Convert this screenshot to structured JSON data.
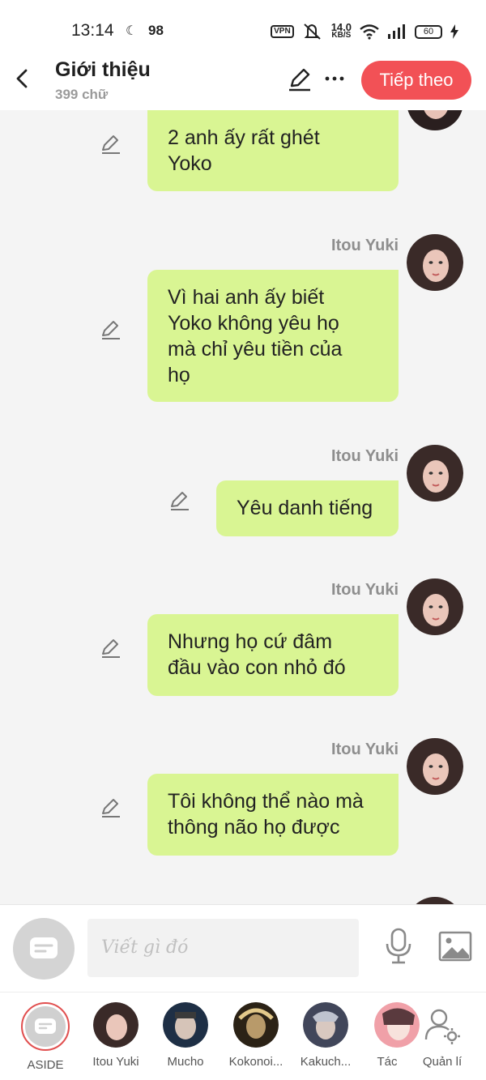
{
  "status_bar": {
    "time": "13:14",
    "notification_count": "98",
    "network_speed": "14.0",
    "network_unit": "KB/S",
    "vpn_label": "VPN",
    "battery": "60"
  },
  "header": {
    "title": "Giới thiệu",
    "subtitle": "399 chữ",
    "next_label": "Tiếp theo"
  },
  "messages": [
    {
      "sender": "",
      "text_lines": [
        "2 anh ấy rất ghét",
        "Yoko"
      ]
    },
    {
      "sender": "Itou Yuki",
      "text_lines": [
        "Vì hai anh ấy biết",
        "Yoko không yêu họ",
        "mà chỉ yêu tiền của",
        "họ"
      ]
    },
    {
      "sender": "Itou Yuki",
      "text_lines": [
        "Yêu danh tiếng"
      ]
    },
    {
      "sender": "Itou Yuki",
      "text_lines": [
        "Nhưng họ cứ đâm",
        "đầu vào con nhỏ đó"
      ]
    },
    {
      "sender": "Itou Yuki",
      "text_lines": [
        "Tôi không thể nào mà",
        "thông não họ được"
      ]
    }
  ],
  "input": {
    "placeholder": "Viết gì đó"
  },
  "characters": [
    {
      "name": "ASIDE",
      "active": true
    },
    {
      "name": "Itou Yuki"
    },
    {
      "name": "Mucho"
    },
    {
      "name": "Kokonoi..."
    },
    {
      "name": "Kakuch..."
    },
    {
      "name": "Tác"
    },
    {
      "name": "Quản lí"
    }
  ],
  "colors": {
    "accent": "#f25156",
    "bubble": "#d9f593",
    "background": "#f4f4f4"
  }
}
